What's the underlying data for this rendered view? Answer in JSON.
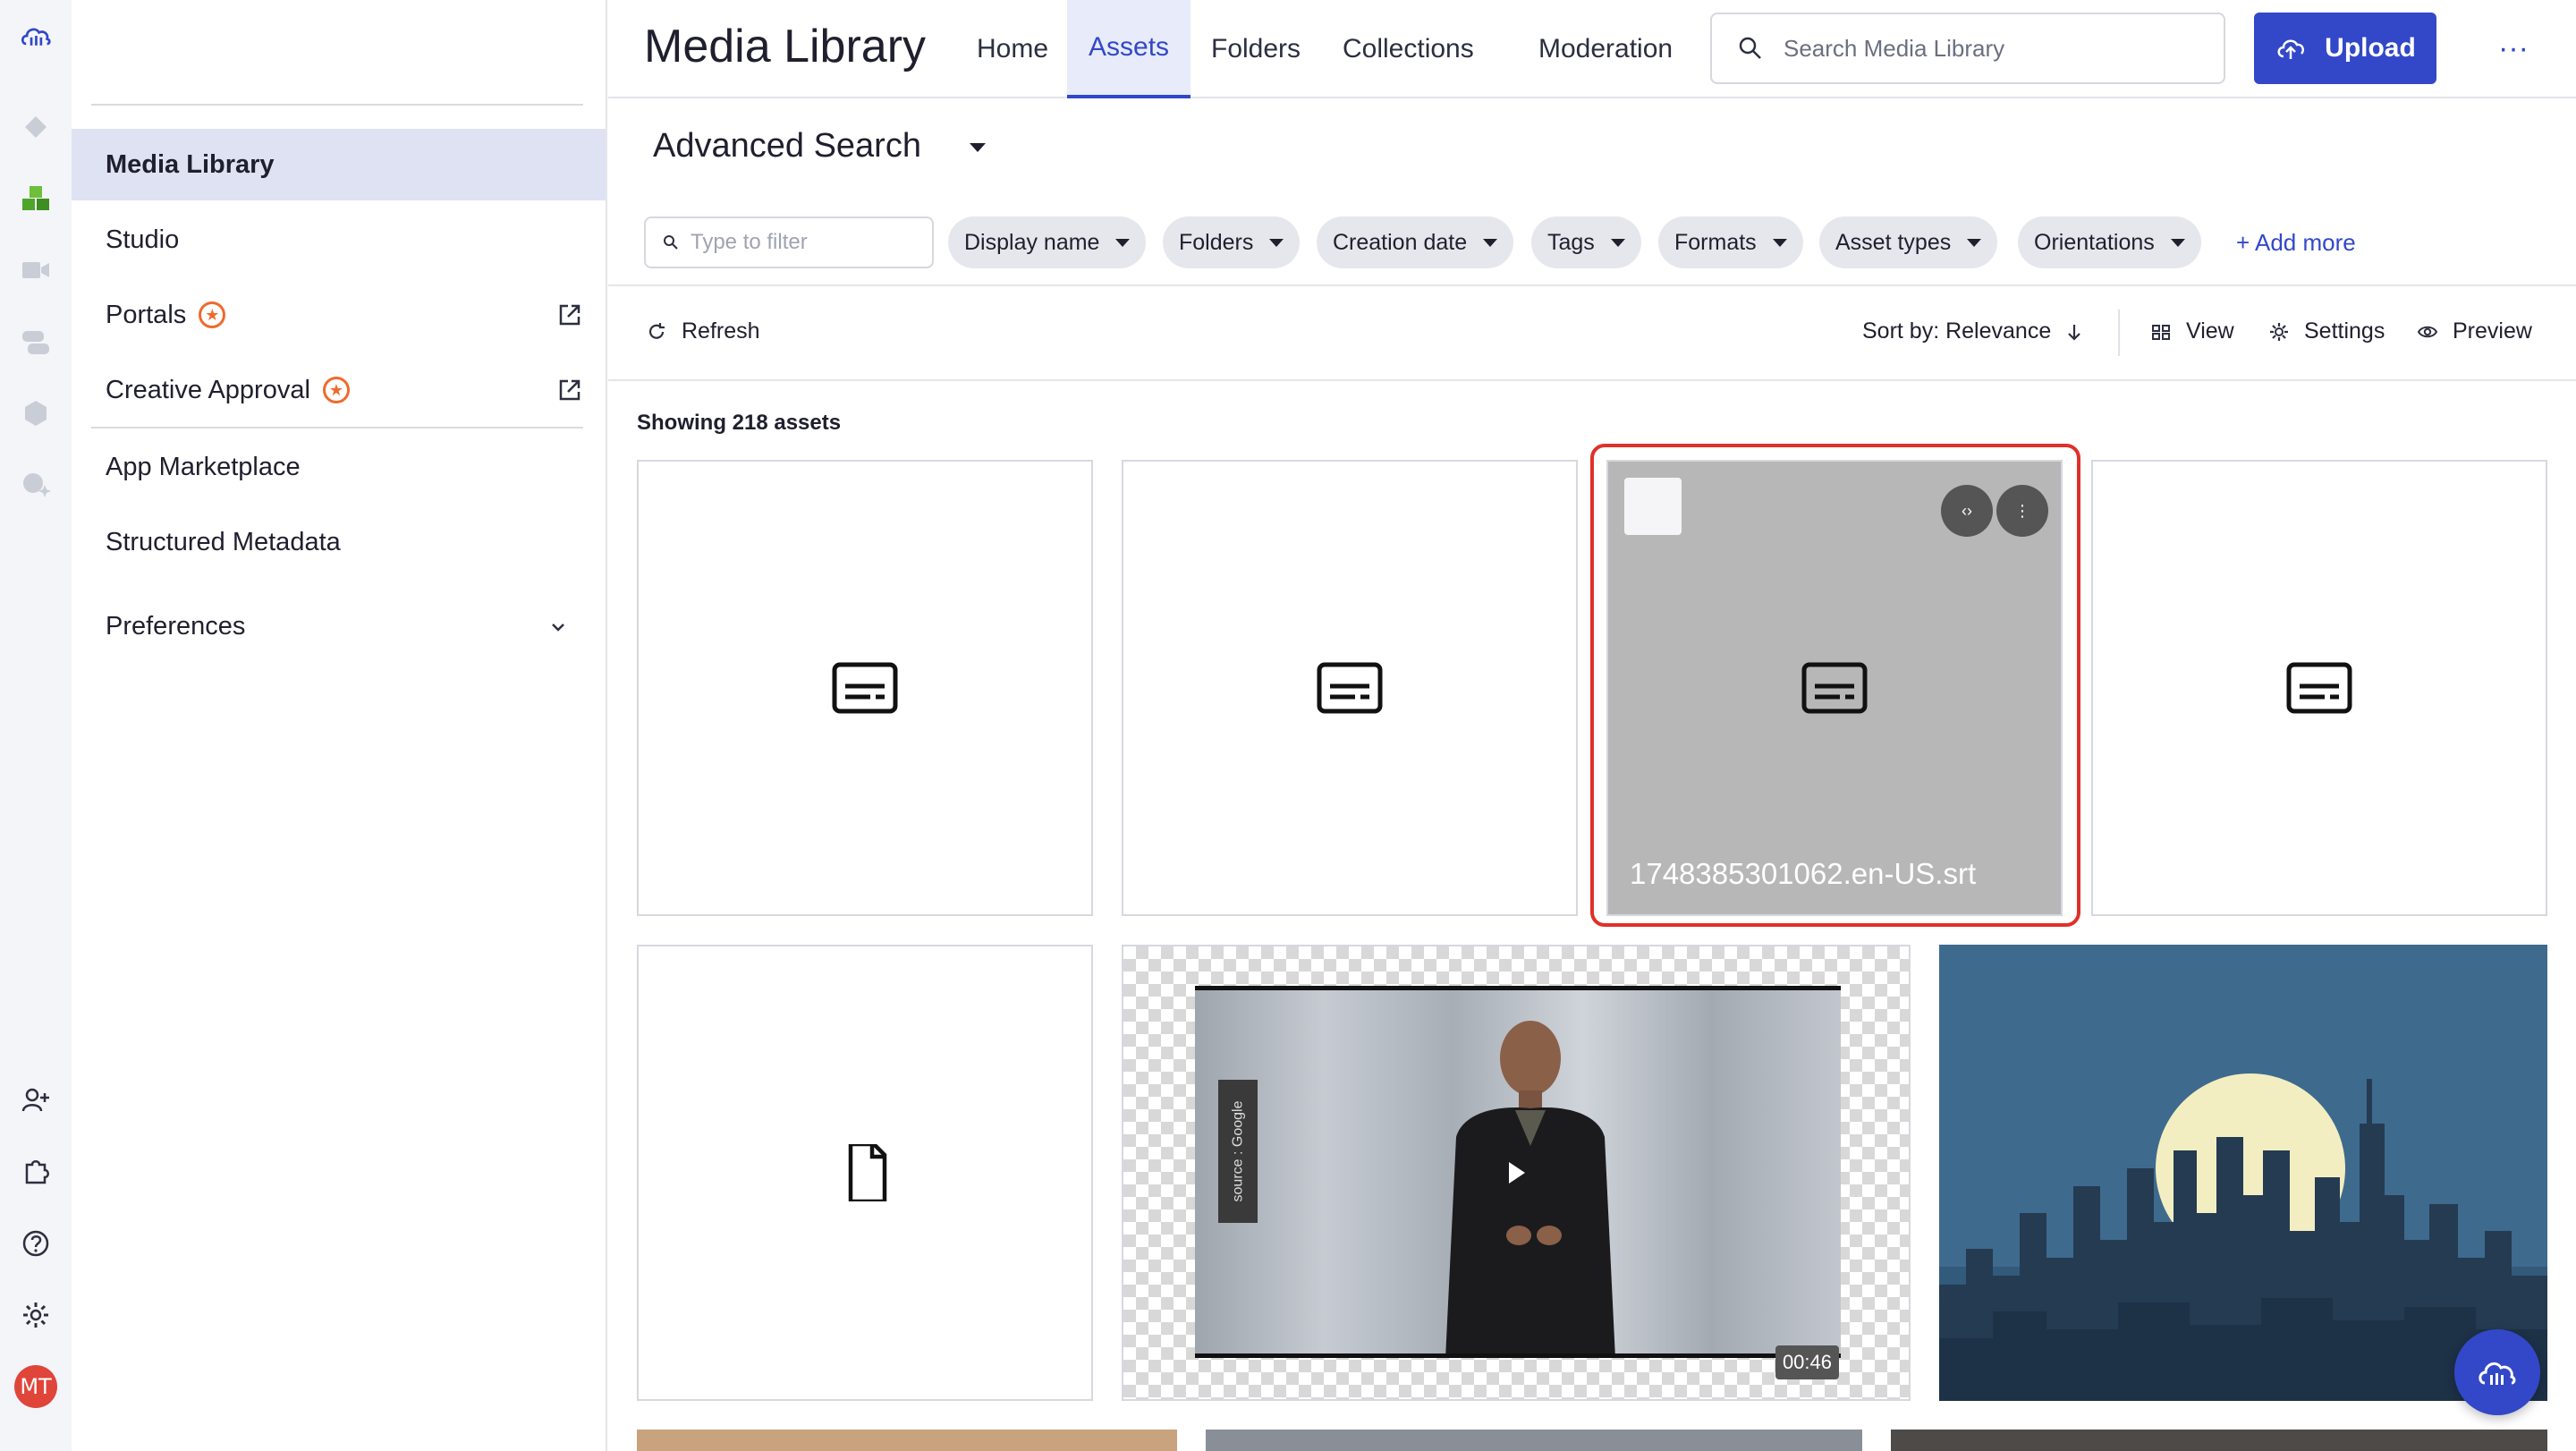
{
  "rail": {
    "icons": [
      "cloud-logo-icon",
      "diamond-icon",
      "cubes-icon",
      "video-icon",
      "chat-icon",
      "hexagon-icon",
      "sparkle-chat-icon"
    ],
    "bottom_icons": [
      "add-user-icon",
      "puzzle-icon",
      "help-icon",
      "gear-icon"
    ],
    "avatar": "MT"
  },
  "sidebar": {
    "items": [
      {
        "label": "Media Library",
        "active": true
      },
      {
        "label": "Studio"
      },
      {
        "label": "Portals",
        "badge": true,
        "external": true
      },
      {
        "label": "Creative Approval",
        "badge": true,
        "external": true
      },
      {
        "label": "App Marketplace"
      },
      {
        "label": "Structured Metadata"
      },
      {
        "label": "Preferences",
        "expandable": true
      }
    ]
  },
  "header": {
    "title": "Media Library",
    "tabs": [
      {
        "label": "Home"
      },
      {
        "label": "Assets",
        "active": true
      },
      {
        "label": "Folders"
      },
      {
        "label": "Collections"
      },
      {
        "label": "Moderation"
      }
    ],
    "search_placeholder": "Search Media Library",
    "upload_label": "Upload",
    "more_label": "···"
  },
  "search": {
    "title": "Advanced Search",
    "filter_placeholder": "Type to filter",
    "chips": [
      "Display name",
      "Folders",
      "Creation date",
      "Tags",
      "Formats",
      "Asset types",
      "Orientations"
    ],
    "add_more": "+ Add more"
  },
  "toolbar": {
    "refresh": "Refresh",
    "sort": "Sort by: Relevance",
    "view": "View",
    "settings": "Settings",
    "preview": "Preview"
  },
  "results": {
    "count_label": "Showing 218 assets",
    "hovered_filename": "1748385301062.en-US.srt",
    "video_duration": "00:46",
    "video_source_tag": "source : Google"
  },
  "colors": {
    "accent": "#3248c8",
    "highlight": "#e0302a",
    "badge": "#ef6a2c",
    "avatar": "#e0453a"
  }
}
